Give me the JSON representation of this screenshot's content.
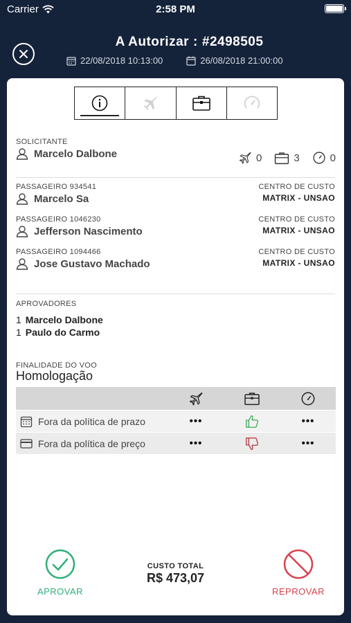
{
  "status_bar": {
    "carrier": "Carrier",
    "time": "2:58 PM"
  },
  "header": {
    "title_prefix": "A Autorizar",
    "title_sep": ":",
    "order_number": "#2498505",
    "date_start": "22/08/2018 10:13:00",
    "date_end": "26/08/2018 21:00:00"
  },
  "tabs": [
    {
      "icon": "info-icon",
      "active": true
    },
    {
      "icon": "airplane-icon",
      "active": false
    },
    {
      "icon": "briefcase-icon",
      "active": false
    },
    {
      "icon": "speedometer-icon",
      "active": false
    }
  ],
  "solicitante": {
    "label": "SOLICITANTE",
    "name": "Marcelo Dalbone"
  },
  "counters": {
    "flights": "0",
    "hotels": "3",
    "others": "0"
  },
  "passengers": [
    {
      "label": "PASSAGEIRO 934541",
      "name": "Marcelo Sa",
      "cc_label": "CENTRO DE CUSTO",
      "cc_value": "MATRIX - UNSAO"
    },
    {
      "label": "PASSAGEIRO 1046230",
      "name": "Jefferson Nascimento",
      "cc_label": "CENTRO DE CUSTO",
      "cc_value": "MATRIX - UNSAO"
    },
    {
      "label": "PASSAGEIRO 1094466",
      "name": "Jose Gustavo Machado",
      "cc_label": "CENTRO DE CUSTO",
      "cc_value": "MATRIX - UNSAO"
    }
  ],
  "aprovadores": {
    "label": "APROVADORES",
    "items": [
      {
        "n": "1",
        "name": "Marcelo Dalbone"
      },
      {
        "n": "1",
        "name": "Paulo do Carmo"
      }
    ]
  },
  "finalidade": {
    "label": "FINALIDADE DO VOO",
    "value": "Homologação"
  },
  "policy": {
    "rows": [
      {
        "label": "Fora da política de prazo",
        "flight": "•••",
        "hotel": "thumbs-up",
        "other": "•••"
      },
      {
        "label": "Fora da política de preço",
        "flight": "•••",
        "hotel": "thumbs-down",
        "other": "•••"
      }
    ]
  },
  "footer": {
    "approve_label": "APROVAR",
    "reject_label": "REPROVAR",
    "total_label": "CUSTO TOTAL",
    "total_value": "R$ 473,07"
  },
  "colors": {
    "background": "#14223a",
    "approve": "#2fae7a",
    "reject": "#d8414d",
    "thumb_up": "#3aa852",
    "thumb_down": "#b3343f"
  }
}
